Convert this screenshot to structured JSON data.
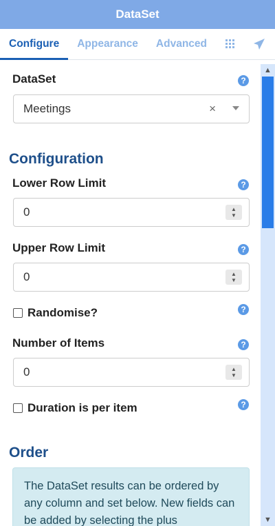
{
  "header": {
    "title": "DataSet"
  },
  "tabs": [
    {
      "label": "Configure"
    },
    {
      "label": "Appearance"
    },
    {
      "label": "Advanced"
    }
  ],
  "tab_icons": [
    "grid-icon",
    "send-icon"
  ],
  "form": {
    "dataset_label": "DataSet",
    "dataset_value": "Meetings",
    "configuration_heading": "Configuration",
    "lower_row_limit_label": "Lower Row Limit",
    "lower_row_limit_value": "0",
    "upper_row_limit_label": "Upper Row Limit",
    "upper_row_limit_value": "0",
    "randomise_label": "Randomise?",
    "number_of_items_label": "Number of Items",
    "number_of_items_value": "0",
    "duration_label": "Duration is per item",
    "order_heading": "Order",
    "order_info": "The DataSet results can be ordered by any column and set below. New fields can be added by selecting the plus"
  },
  "help_glyph": "?",
  "colors": {
    "header": "#7fa9e6",
    "active_tab": "#1a5fb4",
    "section_heading": "#1e4f8a",
    "help_icon": "#5b9ae6",
    "scroll_thumb": "#2a7de8",
    "info_bg": "#d4ebf1"
  }
}
